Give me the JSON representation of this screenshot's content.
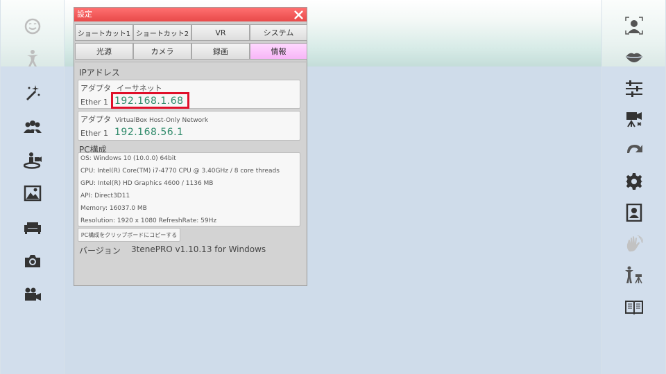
{
  "left_sidebar": {
    "icons": [
      "face-icon",
      "pose-icon",
      "magic-wand-icon",
      "group-icon",
      "motion-capture-icon",
      "image-icon",
      "sofa-icon",
      "camera-icon",
      "video-camera-icon"
    ]
  },
  "right_sidebar": {
    "icons": [
      "face-tracking-icon",
      "lips-icon",
      "sliders-icon",
      "camera-record-icon",
      "redo-icon",
      "gear-icon",
      "portrait-icon",
      "hand-wave-icon",
      "tripod-pose-icon",
      "book-icon"
    ]
  },
  "dialog": {
    "title": "設定",
    "close_symbol": "✕",
    "tabs_row1": [
      "ショートカット1",
      "ショートカット2",
      "VR",
      "システム"
    ],
    "tabs_row2": [
      "光源",
      "カメラ",
      "録画",
      "情報"
    ],
    "active_tab": "情報",
    "ip_section": {
      "heading": "IPアドレス",
      "adapters": [
        {
          "adapter_label": "アダプタ",
          "adapter_name": "イーサネット",
          "ether_label": "Ether 1",
          "ip": "192.168.1.68"
        },
        {
          "adapter_label": "アダプタ",
          "adapter_name": "VirtualBox Host-Only Network",
          "ether_label": "Ether 1",
          "ip": "192.168.56.1"
        }
      ]
    },
    "pc_section": {
      "heading": "PC構成",
      "lines": [
        "OS: Windows 10  (10.0.0) 64bit",
        "CPU: Intel(R) Core(TM) i7-4770 CPU @ 3.40GHz / 8 core threads",
        "GPU: Intel(R) HD Graphics 4600 / 1136 MB",
        "API: Direct3D11",
        "Memory: 16037.0 MB",
        "Resolution: 1920 x 1080 RefreshRate: 59Hz"
      ],
      "copy_button": "PC構成をクリップボードにコピーする"
    },
    "version": {
      "label": "バージョン",
      "value": "3tenePRO v1.10.13 for Windows"
    }
  },
  "colors": {
    "titlebar": "#f05a5a",
    "active_tab": "#f9c0f9",
    "ip_text": "#2f8a6a",
    "highlight": "#e0102a"
  }
}
